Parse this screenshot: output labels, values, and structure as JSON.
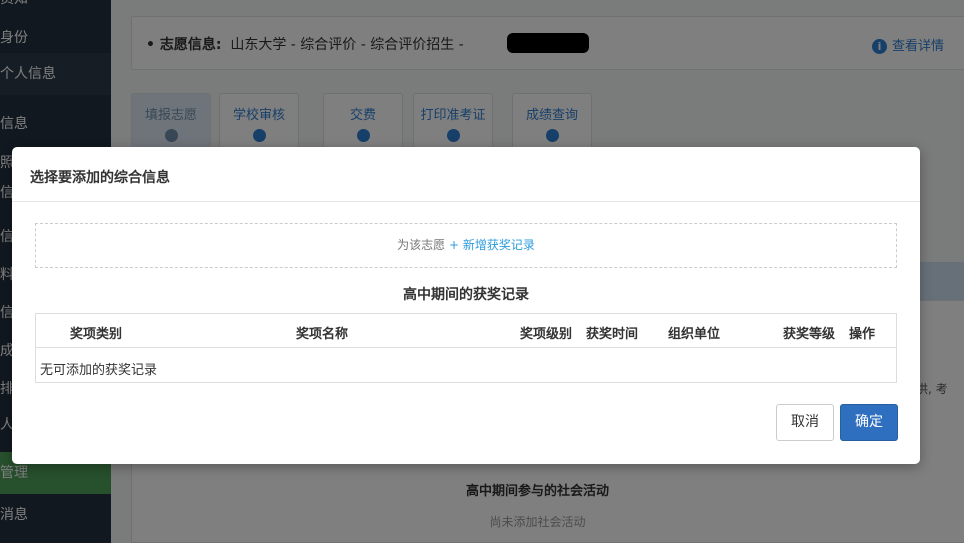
{
  "sidebar": {
    "items": [
      {
        "label": "员知"
      },
      {
        "label": "身份"
      },
      {
        "label": "个人信息"
      },
      {
        "label": "信息"
      },
      {
        "label": "照"
      },
      {
        "label": "信"
      },
      {
        "label": "信"
      },
      {
        "label": "料"
      },
      {
        "label": "信"
      },
      {
        "label": "成"
      },
      {
        "label": "排"
      },
      {
        "label": "人"
      },
      {
        "label": "管理"
      },
      {
        "label": "消息"
      }
    ]
  },
  "info_bar": {
    "label": "• 志愿信息:",
    "text": "山东大学 - 综合评价 - 综合评价招生 -",
    "detail": "查看详情"
  },
  "steps": [
    {
      "label": "填报志愿"
    },
    {
      "label": "学校审核"
    },
    {
      "label": "交费"
    },
    {
      "label": "打印准考证"
    },
    {
      "label": "成绩查询"
    }
  ],
  "background": {
    "side_text": "供, 考",
    "section_title": "高中期间参与的社会活动",
    "section_empty": "尚未添加社会活动"
  },
  "modal": {
    "title": "选择要添加的综合信息",
    "add_prefix": "为该志愿",
    "add_link": "+ 新增获奖记录",
    "section_title": "高中期间的获奖记录",
    "columns": [
      "奖项类别",
      "奖项名称",
      "奖项级别",
      "获奖时间",
      "组织单位",
      "获奖等级",
      "操作"
    ],
    "empty_text": "无可添加的获奖记录",
    "cancel": "取消",
    "confirm": "确定"
  },
  "colors": {
    "accent": "#2d7fd3",
    "primary_button": "#2f6fbf",
    "sidebar": "#22313f",
    "sidebar_active": "#4fa05a"
  }
}
